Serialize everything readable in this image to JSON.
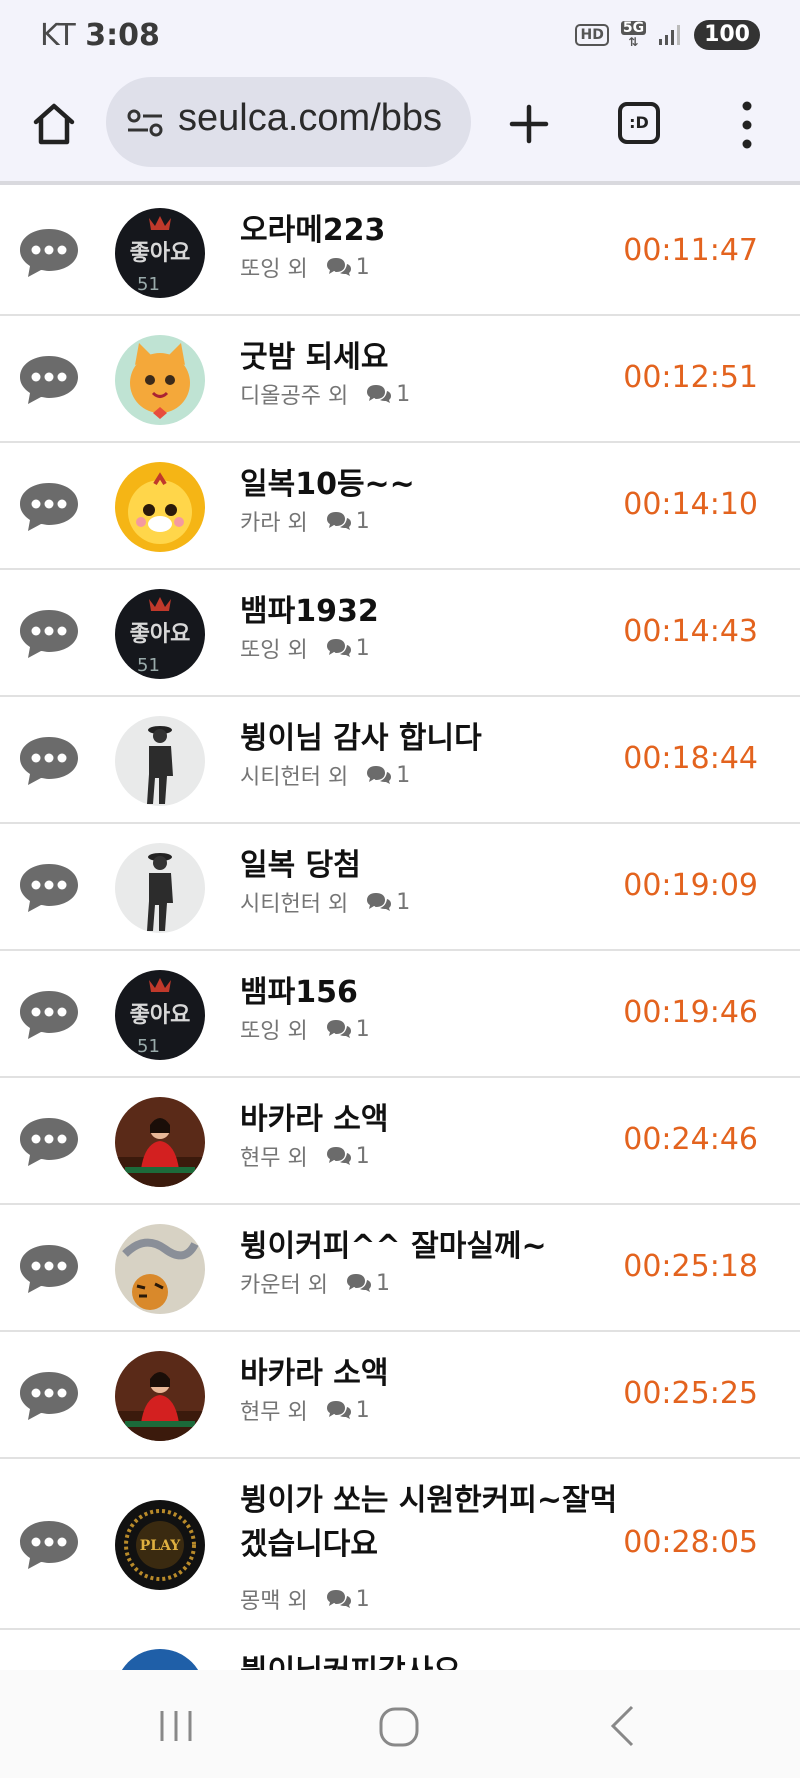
{
  "status_bar": {
    "carrier": "KT",
    "time": "3:08",
    "hd": "HD",
    "network": "5G",
    "battery": "100"
  },
  "toolbar": {
    "url": "seulca.com/bbs",
    "tabs_label": ":D"
  },
  "posts": [
    {
      "title": "오라메223",
      "author": "또잉 외",
      "comments": "1",
      "time": "00:11:47",
      "avatar": "좋아요 sign"
    },
    {
      "title": "굿밤 되세요",
      "author": "디올공주 외",
      "comments": "1",
      "time": "00:12:51",
      "avatar": "cartoon cat"
    },
    {
      "title": "일복10등~~",
      "author": "카라 외",
      "comments": "1",
      "time": "00:14:10",
      "avatar": "cartoon tiger"
    },
    {
      "title": "뱀파1932",
      "author": "또잉 외",
      "comments": "1",
      "time": "00:14:43",
      "avatar": "좋아요 sign"
    },
    {
      "title": "뷩이님 감사 합니다",
      "author": "시티헌터 외",
      "comments": "1",
      "time": "00:18:44",
      "avatar": "walking man"
    },
    {
      "title": "일복 당첨",
      "author": "시티헌터 외",
      "comments": "1",
      "time": "00:19:09",
      "avatar": "walking man"
    },
    {
      "title": "뱀파156",
      "author": "또잉 외",
      "comments": "1",
      "time": "00:19:46",
      "avatar": "좋아요 sign"
    },
    {
      "title": "바카라 소액",
      "author": "현무 외",
      "comments": "1",
      "time": "00:24:46",
      "avatar": "woman in red"
    },
    {
      "title": "뷩이커피^^ 잘마실께~",
      "author": "카운터 외",
      "comments": "1",
      "time": "00:25:18",
      "avatar": "dragon and tiger"
    },
    {
      "title": "바카라 소액",
      "author": "현무 외",
      "comments": "1",
      "time": "00:25:25",
      "avatar": "woman in red"
    },
    {
      "title": "뷩이가 쏘는 시원한커피~잘먹겠습니다요",
      "author": "몽맥 외",
      "comments": "1",
      "time": "00:28:05",
      "avatar": "gold emblem"
    },
    {
      "title": "뷩이님커피감사요",
      "author": "",
      "comments": "",
      "time": "",
      "avatar": "blue circle"
    }
  ],
  "colors": {
    "time": "#e3631e",
    "chrome_bg": "#f3f3fb",
    "url_pill": "#dfe0ea",
    "chat_icon": "#6b6b6b"
  }
}
